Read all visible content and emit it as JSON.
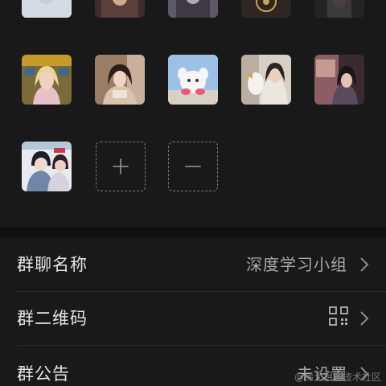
{
  "settings": {
    "rows": [
      {
        "label": "群聊名称",
        "value": "深度学习小组"
      },
      {
        "label": "群二维码",
        "value": "",
        "icon": "qr-code-icon"
      },
      {
        "label": "群公告",
        "value": "未设置"
      }
    ]
  },
  "members": {
    "add_icon": "plus-icon",
    "remove_icon": "minus-icon"
  },
  "watermark": "@稀土掘金技术社区",
  "colors": {
    "background": "#111111",
    "panel": "#191919",
    "text": "#e4e4e4",
    "muted": "#a9a9a9"
  }
}
